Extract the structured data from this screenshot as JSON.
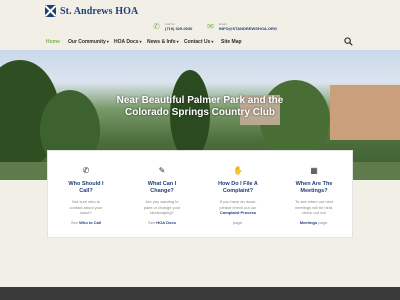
{
  "site": {
    "title": "St. Andrews HOA"
  },
  "contact": {
    "phone_label": "Call Us",
    "phone_value": "(719) 329-0030",
    "email_label": "Email",
    "email_value": "INFO@STANDREWSHOA.ORG"
  },
  "nav": {
    "items": [
      {
        "label": "Home",
        "dropdown": false,
        "active": true
      },
      {
        "label": "Our Community",
        "dropdown": true,
        "active": false
      },
      {
        "label": "HOA Docs",
        "dropdown": true,
        "active": false
      },
      {
        "label": "News & Info",
        "dropdown": true,
        "active": false
      },
      {
        "label": "Contact Us",
        "dropdown": true,
        "active": false
      },
      {
        "label": "Site Map",
        "dropdown": false,
        "active": false
      }
    ],
    "caret": "▾"
  },
  "hero": {
    "title_line1": "Near Beautiful Palmer Park and the",
    "title_line2": "Colorado Springs Country Club"
  },
  "cards": [
    {
      "icon": "phone-icon",
      "title_l1": "Who Should I",
      "title_l2": "Call?",
      "desc_l1": "Not sure who to",
      "desc_l2": "contact about your",
      "desc_l3": "issue?",
      "link_prefix": "See",
      "link_text": "Who to Call",
      "link_suffix": ""
    },
    {
      "icon": "brush-icon",
      "title_l1": "What Can I",
      "title_l2": "Change?",
      "desc_l1": "Are you wanting to",
      "desc_l2": "paint or change your",
      "desc_l3": "landscaping?",
      "link_prefix": "See",
      "link_text": "HOA Docs",
      "link_suffix": ""
    },
    {
      "icon": "thumbs-down-icon",
      "title_l1": "How Do I File A",
      "title_l2": "Complaint?",
      "desc_l1": "If you have an issue,",
      "desc_l2": "please check out our",
      "desc_l3": "Complaint Process",
      "link_prefix": "",
      "link_text": "",
      "link_suffix": "page."
    },
    {
      "icon": "calendar-icon",
      "title_l1": "When Are The",
      "title_l2": "Meetings?",
      "desc_l1": "To see when our next",
      "desc_l2": "meetings will be held,",
      "desc_l3": "check out our",
      "link_prefix": "",
      "link_text": "Meetings",
      "link_suffix": "page."
    }
  ],
  "colors": {
    "brand_blue": "#1f3d7a",
    "accent_green": "#7ab24a",
    "footer": "#3a3a3a"
  }
}
